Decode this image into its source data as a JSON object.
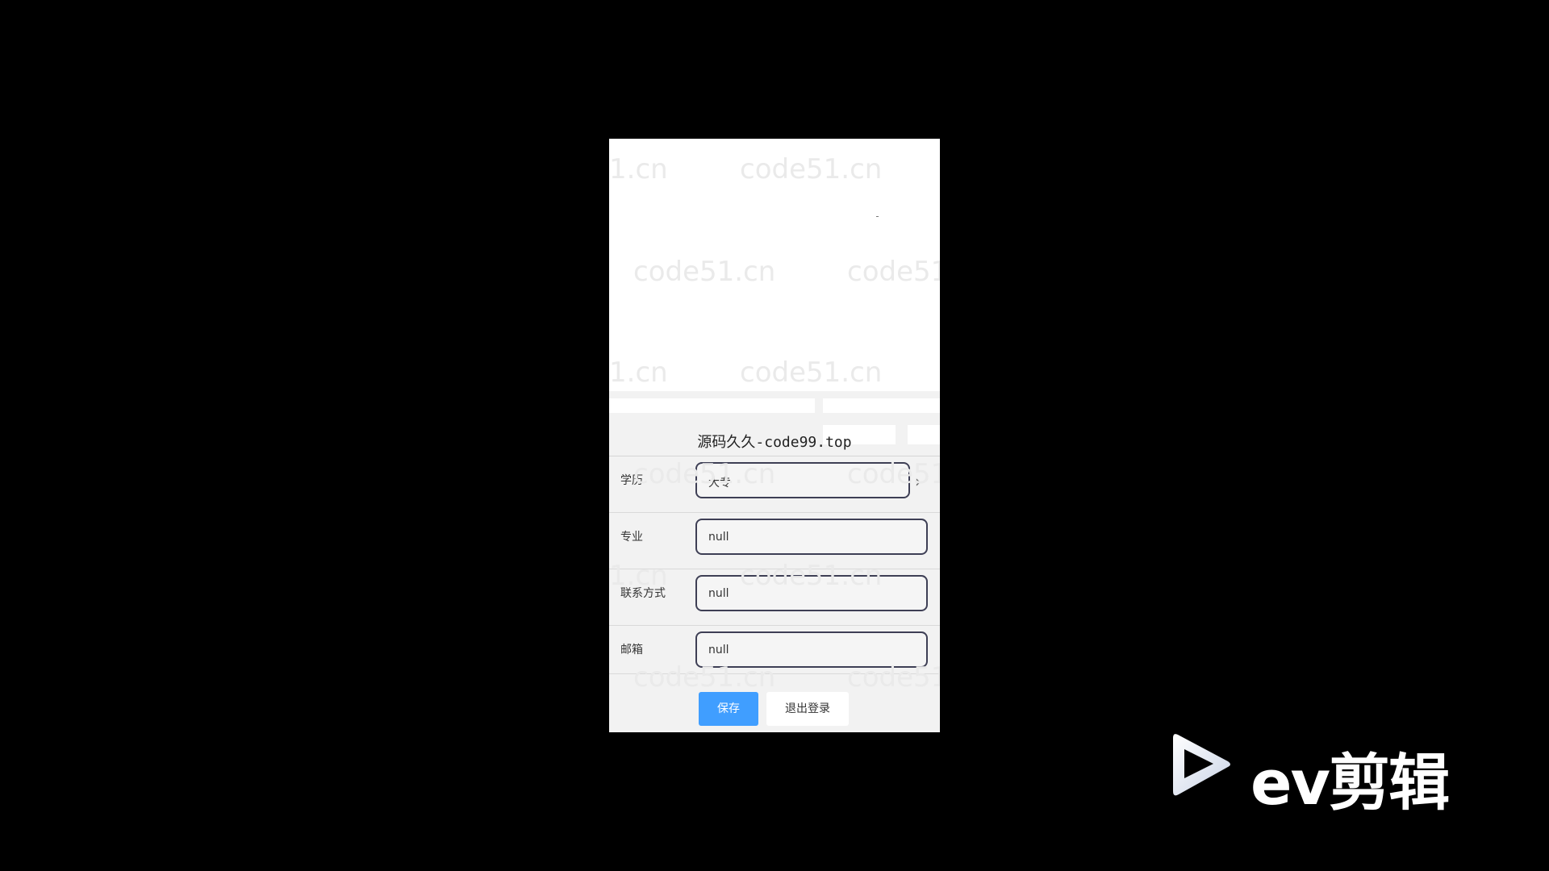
{
  "site_title": "源码久久-code99.top",
  "watermark_text": "code51.cn",
  "watermark_partial": "1.cn",
  "form": {
    "education": {
      "label": "学历",
      "value": "大专"
    },
    "major": {
      "label": "专业",
      "value": "null"
    },
    "contact": {
      "label": "联系方式",
      "value": "null"
    },
    "email": {
      "label": "邮箱",
      "value": "null"
    }
  },
  "buttons": {
    "save": "保存",
    "logout": "退出登录"
  },
  "overlay_logo": {
    "text": "ev剪辑",
    "icon": "play-icon"
  },
  "colors": {
    "save_button": "#409eff",
    "background": "#000000"
  }
}
